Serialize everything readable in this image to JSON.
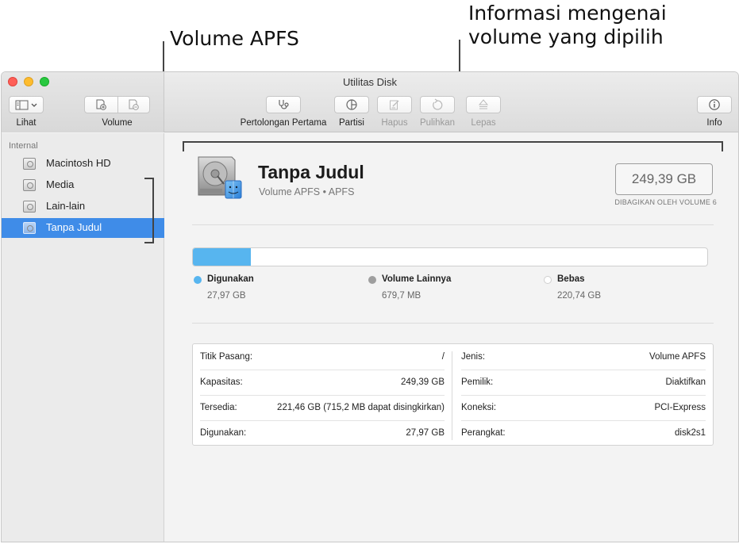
{
  "callouts": {
    "apfs_volume": "Volume APFS",
    "selected_info_line1": "Informasi mengenai",
    "selected_info_line2": "volume yang dipilih"
  },
  "window": {
    "title": "Utilitas Disk"
  },
  "toolbar": {
    "view_label": "Lihat",
    "volume_label": "Volume",
    "first_aid_label": "Pertolongan Pertama",
    "partition_label": "Partisi",
    "erase_label": "Hapus",
    "restore_label": "Pulihkan",
    "unmount_label": "Lepas",
    "info_label": "Info"
  },
  "sidebar": {
    "section": "Internal",
    "items": [
      {
        "label": "Macintosh HD",
        "selected": false
      },
      {
        "label": "Media",
        "selected": false
      },
      {
        "label": "Lain-lain",
        "selected": false
      },
      {
        "label": "Tanpa Judul",
        "selected": true
      }
    ]
  },
  "volume": {
    "name": "Tanpa Judul",
    "subtitle": "Volume APFS • APFS",
    "capacity": "249,39 GB",
    "shared_note": "DIBAGIKAN OLEH VOLUME 6"
  },
  "usage": {
    "used_fraction": 0.112,
    "legend": [
      {
        "name": "Digunakan",
        "value": "27,97 GB",
        "color": "#57b5ef"
      },
      {
        "name": "Volume Lainnya",
        "value": "679,7 MB",
        "color": "#9e9e9e"
      },
      {
        "name": "Bebas",
        "value": "220,74 GB",
        "color": "#ffffff"
      }
    ]
  },
  "details": {
    "left": [
      {
        "label": "Titik Pasang:",
        "value": "/"
      },
      {
        "label": "Kapasitas:",
        "value": "249,39 GB"
      },
      {
        "label": "Tersedia:",
        "value": "221,46 GB (715,2 MB dapat disingkirkan)"
      },
      {
        "label": "Digunakan:",
        "value": "27,97 GB"
      }
    ],
    "right": [
      {
        "label": "Jenis:",
        "value": "Volume APFS"
      },
      {
        "label": "Pemilik:",
        "value": "Diaktifkan"
      },
      {
        "label": "Koneksi:",
        "value": "PCI-Express"
      },
      {
        "label": "Perangkat:",
        "value": "disk2s1"
      }
    ]
  }
}
